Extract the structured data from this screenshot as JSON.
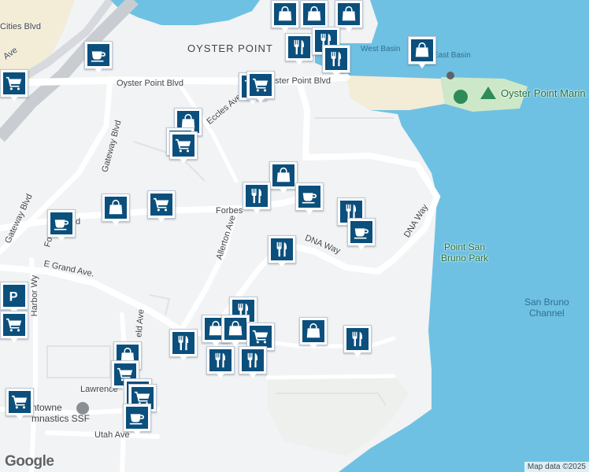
{
  "map": {
    "provider": "Google",
    "attribution": "Map data ©2025",
    "colors": {
      "water": "#6fc1e3",
      "land": "#f1f3f4",
      "road": "#ffffff",
      "park": "#cde8c8",
      "sand": "#f3ecd6",
      "pin": "#0b4f7c"
    }
  },
  "labels": {
    "oyster_point": "OYSTER POINT",
    "oyster_point_blvd_1": "Oyster Point Blvd",
    "oyster_point_blvd_2": "Oyster Point Blvd",
    "cities_blvd": "Cities Blvd",
    "ave_frag": "Ave",
    "gateway_blvd_1": "Gateway Blvd",
    "gateway_blvd_2": "Gateway Blvd",
    "eccles_ave": "Eccles Ave",
    "forbes": "Forbes",
    "forbes_frag": "d",
    "for_frag": "For",
    "allerton_ave": "Allerton Ave",
    "dna_way_1": "DNA Way",
    "dna_way_2": "DNA Way",
    "e_grand_ave": "E Grand Ave.",
    "harbor_wy": "Harbor Wy",
    "field_ave": "eld Ave",
    "lawrence": "Lawrence",
    "utah_ave": "Utah Ave",
    "gymnastics_1": "ntowne",
    "gymnastics_2": "mnastics SSF",
    "west_basin": "West Basin",
    "east_basin": "East Basin",
    "oyster_point_marina": "Oyster Point Marin",
    "point_san_bruno_park": "Point San\nBruno Park",
    "san_bruno_channel": "San Bruno\nChannel"
  },
  "pins": [
    {
      "type": "shopping",
      "icon": "shopping-bag-icon"
    },
    {
      "type": "shopping",
      "icon": "shopping-bag-icon"
    },
    {
      "type": "shopping",
      "icon": "shopping-bag-icon"
    },
    {
      "type": "restaurant",
      "icon": "fork-knife-icon"
    },
    {
      "type": "restaurant",
      "icon": "fork-knife-icon"
    },
    {
      "type": "restaurant",
      "icon": "fork-knife-icon"
    },
    {
      "type": "shopping",
      "icon": "shopping-bag-icon"
    },
    {
      "type": "cafe",
      "icon": "coffee-cup-icon"
    },
    {
      "type": "grocery",
      "icon": "shopping-cart-icon"
    },
    {
      "type": "grocery",
      "icon": "shopping-cart-icon"
    },
    {
      "type": "grocery",
      "icon": "shopping-cart-icon"
    },
    {
      "type": "shopping",
      "icon": "shopping-bag-icon"
    },
    {
      "type": "grocery",
      "icon": "shopping-cart-icon"
    },
    {
      "type": "grocery",
      "icon": "shopping-cart-icon"
    },
    {
      "type": "shopping",
      "icon": "shopping-bag-icon"
    },
    {
      "type": "restaurant",
      "icon": "fork-knife-icon"
    },
    {
      "type": "cafe",
      "icon": "coffee-cup-icon"
    },
    {
      "type": "shopping",
      "icon": "shopping-bag-icon"
    },
    {
      "type": "grocery",
      "icon": "shopping-cart-icon"
    },
    {
      "type": "cafe",
      "icon": "coffee-cup-icon"
    },
    {
      "type": "restaurant",
      "icon": "fork-knife-icon"
    },
    {
      "type": "cafe",
      "icon": "coffee-cup-icon"
    },
    {
      "type": "restaurant",
      "icon": "fork-knife-icon"
    },
    {
      "type": "restaurant",
      "icon": "fork-knife-icon"
    },
    {
      "type": "shopping",
      "icon": "shopping-bag-icon"
    },
    {
      "type": "shopping",
      "icon": "shopping-bag-icon"
    },
    {
      "type": "grocery",
      "icon": "shopping-cart-icon"
    },
    {
      "type": "restaurant",
      "icon": "fork-knife-icon"
    },
    {
      "type": "restaurant",
      "icon": "fork-knife-icon"
    },
    {
      "type": "restaurant",
      "icon": "fork-knife-icon"
    },
    {
      "type": "shopping",
      "icon": "shopping-bag-icon"
    },
    {
      "type": "restaurant",
      "icon": "fork-knife-icon"
    },
    {
      "type": "shopping",
      "icon": "shopping-bag-icon"
    },
    {
      "type": "grocery",
      "icon": "shopping-cart-icon"
    },
    {
      "type": "grocery",
      "icon": "shopping-cart-icon"
    },
    {
      "type": "grocery",
      "icon": "shopping-cart-icon"
    },
    {
      "type": "cafe",
      "icon": "coffee-cup-icon"
    },
    {
      "type": "grocery",
      "icon": "shopping-cart-icon"
    },
    {
      "type": "parking",
      "icon": "parking-icon"
    },
    {
      "type": "grocery",
      "icon": "shopping-cart-icon"
    }
  ]
}
